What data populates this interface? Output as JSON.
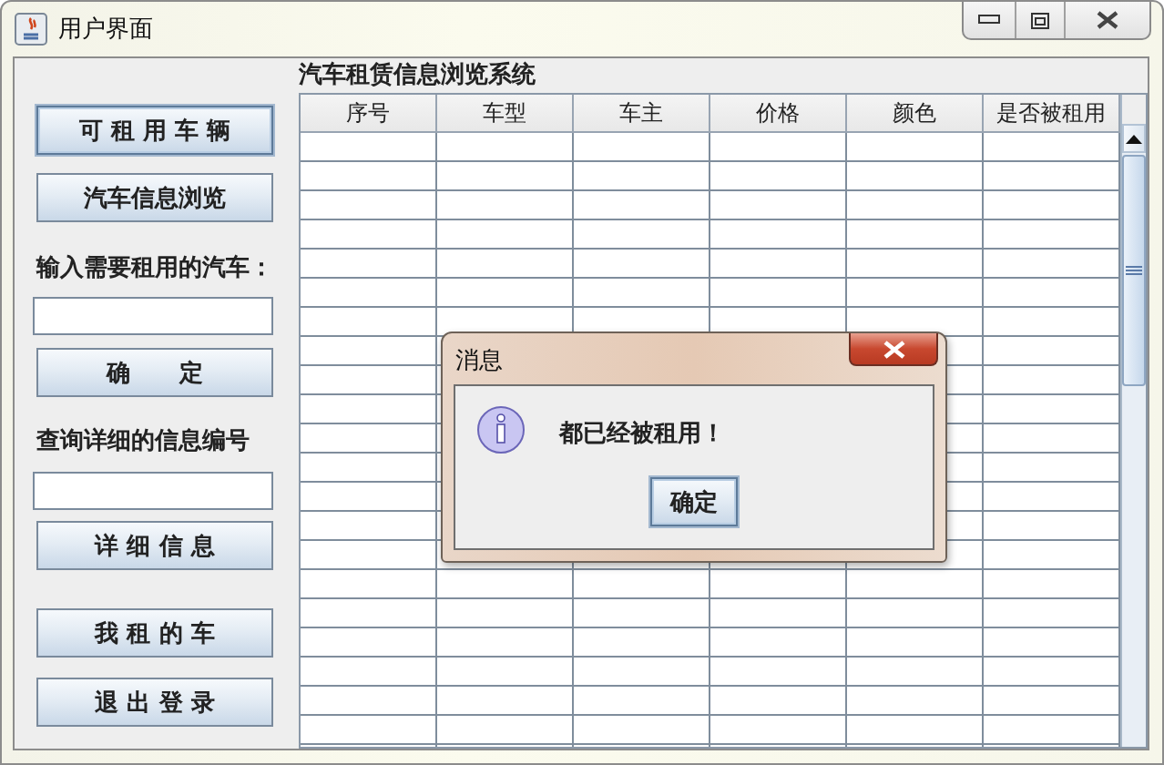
{
  "window": {
    "title": "用户界面"
  },
  "sidebar": {
    "items": [
      {
        "kind": "button",
        "label": "可 租 用 车 辆",
        "focused": true
      },
      {
        "kind": "button",
        "label": "汽车信息浏览",
        "focused": false
      },
      {
        "kind": "label",
        "label": "输入需要租用的汽车："
      },
      {
        "kind": "field"
      },
      {
        "kind": "button",
        "label": "确      定",
        "focused": false
      },
      {
        "kind": "label",
        "label": "查询详细的信息编号"
      },
      {
        "kind": "field"
      },
      {
        "kind": "button",
        "label": "详 细 信 息",
        "focused": false
      },
      {
        "kind": "button",
        "label": "我 租 的 车",
        "focused": false
      },
      {
        "kind": "button",
        "label": "退 出 登 录",
        "focused": false
      }
    ]
  },
  "table": {
    "title": "汽车租赁信息浏览系统",
    "columns": [
      "序号",
      "车型",
      "车主",
      "价格",
      "颜色",
      "是否被租用"
    ]
  },
  "dialog": {
    "title": "消息",
    "message": "都已经被租用！",
    "button": {
      "label": "确定",
      "focused": true
    }
  }
}
